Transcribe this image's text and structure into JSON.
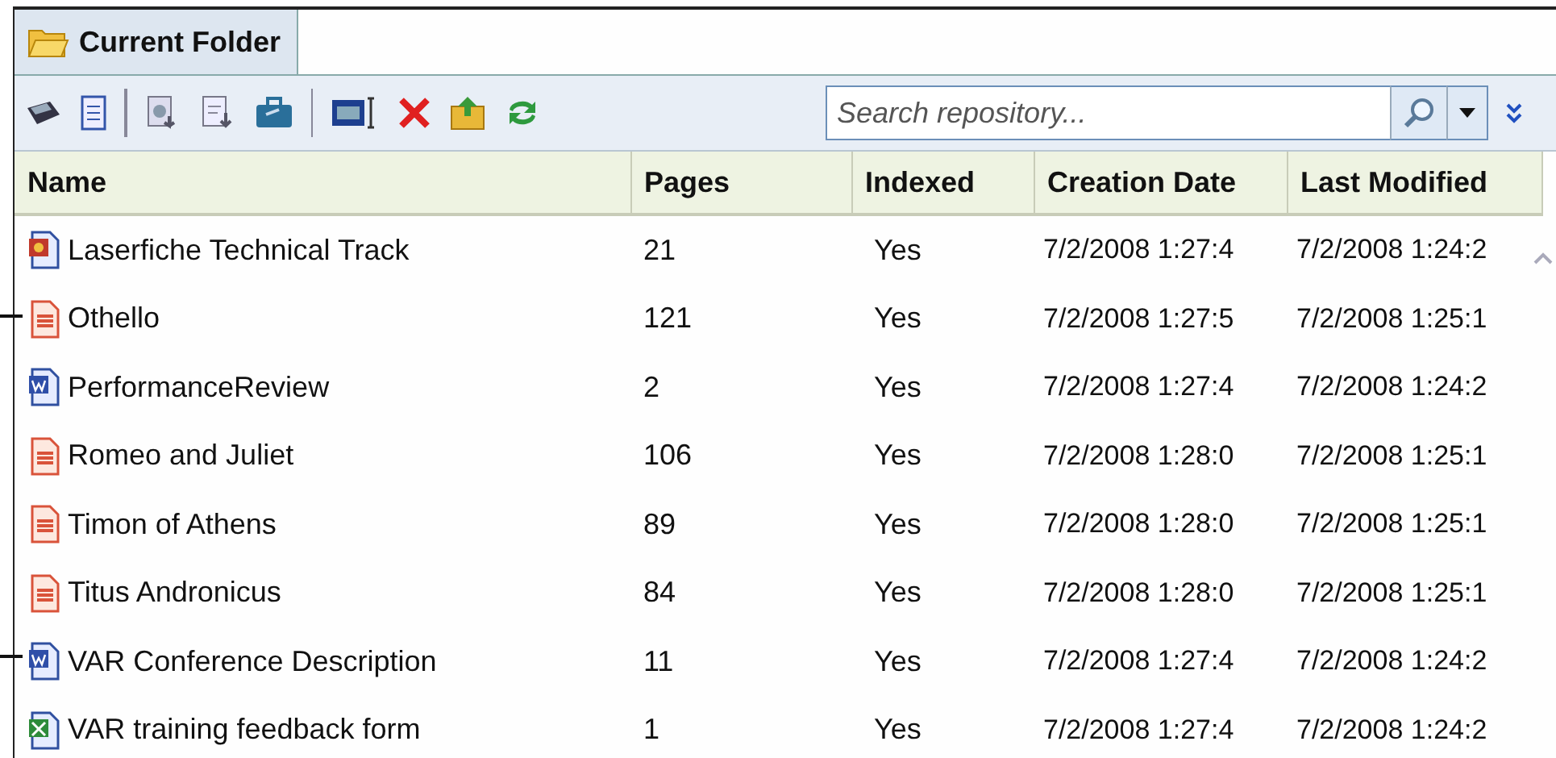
{
  "tab": {
    "title": "Current Folder"
  },
  "search": {
    "placeholder": "Search repository..."
  },
  "table": {
    "columns": [
      "Name",
      "Pages",
      "Indexed",
      "Creation Date",
      "Last Modified"
    ],
    "rows": [
      {
        "kind": "laserfiche",
        "name": "Laserfiche Technical Track",
        "pages": "21",
        "indexed": "Yes",
        "created": "7/2/2008 1:27:4",
        "modified": "7/2/2008 1:24:2"
      },
      {
        "kind": "text",
        "name": "Othello",
        "pages": "121",
        "indexed": "Yes",
        "created": "7/2/2008 1:27:5",
        "modified": "7/2/2008 1:25:1"
      },
      {
        "kind": "word",
        "name": "PerformanceReview",
        "pages": "2",
        "indexed": "Yes",
        "created": "7/2/2008 1:27:4",
        "modified": "7/2/2008 1:24:2"
      },
      {
        "kind": "text",
        "name": "Romeo and Juliet",
        "pages": "106",
        "indexed": "Yes",
        "created": "7/2/2008 1:28:0",
        "modified": "7/2/2008 1:25:1"
      },
      {
        "kind": "text",
        "name": "Timon of Athens",
        "pages": "89",
        "indexed": "Yes",
        "created": "7/2/2008 1:28:0",
        "modified": "7/2/2008 1:25:1"
      },
      {
        "kind": "text",
        "name": "Titus Andronicus",
        "pages": "84",
        "indexed": "Yes",
        "created": "7/2/2008 1:28:0",
        "modified": "7/2/2008 1:25:1"
      },
      {
        "kind": "word",
        "name": "VAR Conference Description",
        "pages": "11",
        "indexed": "Yes",
        "created": "7/2/2008 1:27:4",
        "modified": "7/2/2008 1:24:2"
      },
      {
        "kind": "excel",
        "name": "VAR training feedback form",
        "pages": "1",
        "indexed": "Yes",
        "created": "7/2/2008 1:27:4",
        "modified": "7/2/2008 1:24:2"
      }
    ]
  }
}
